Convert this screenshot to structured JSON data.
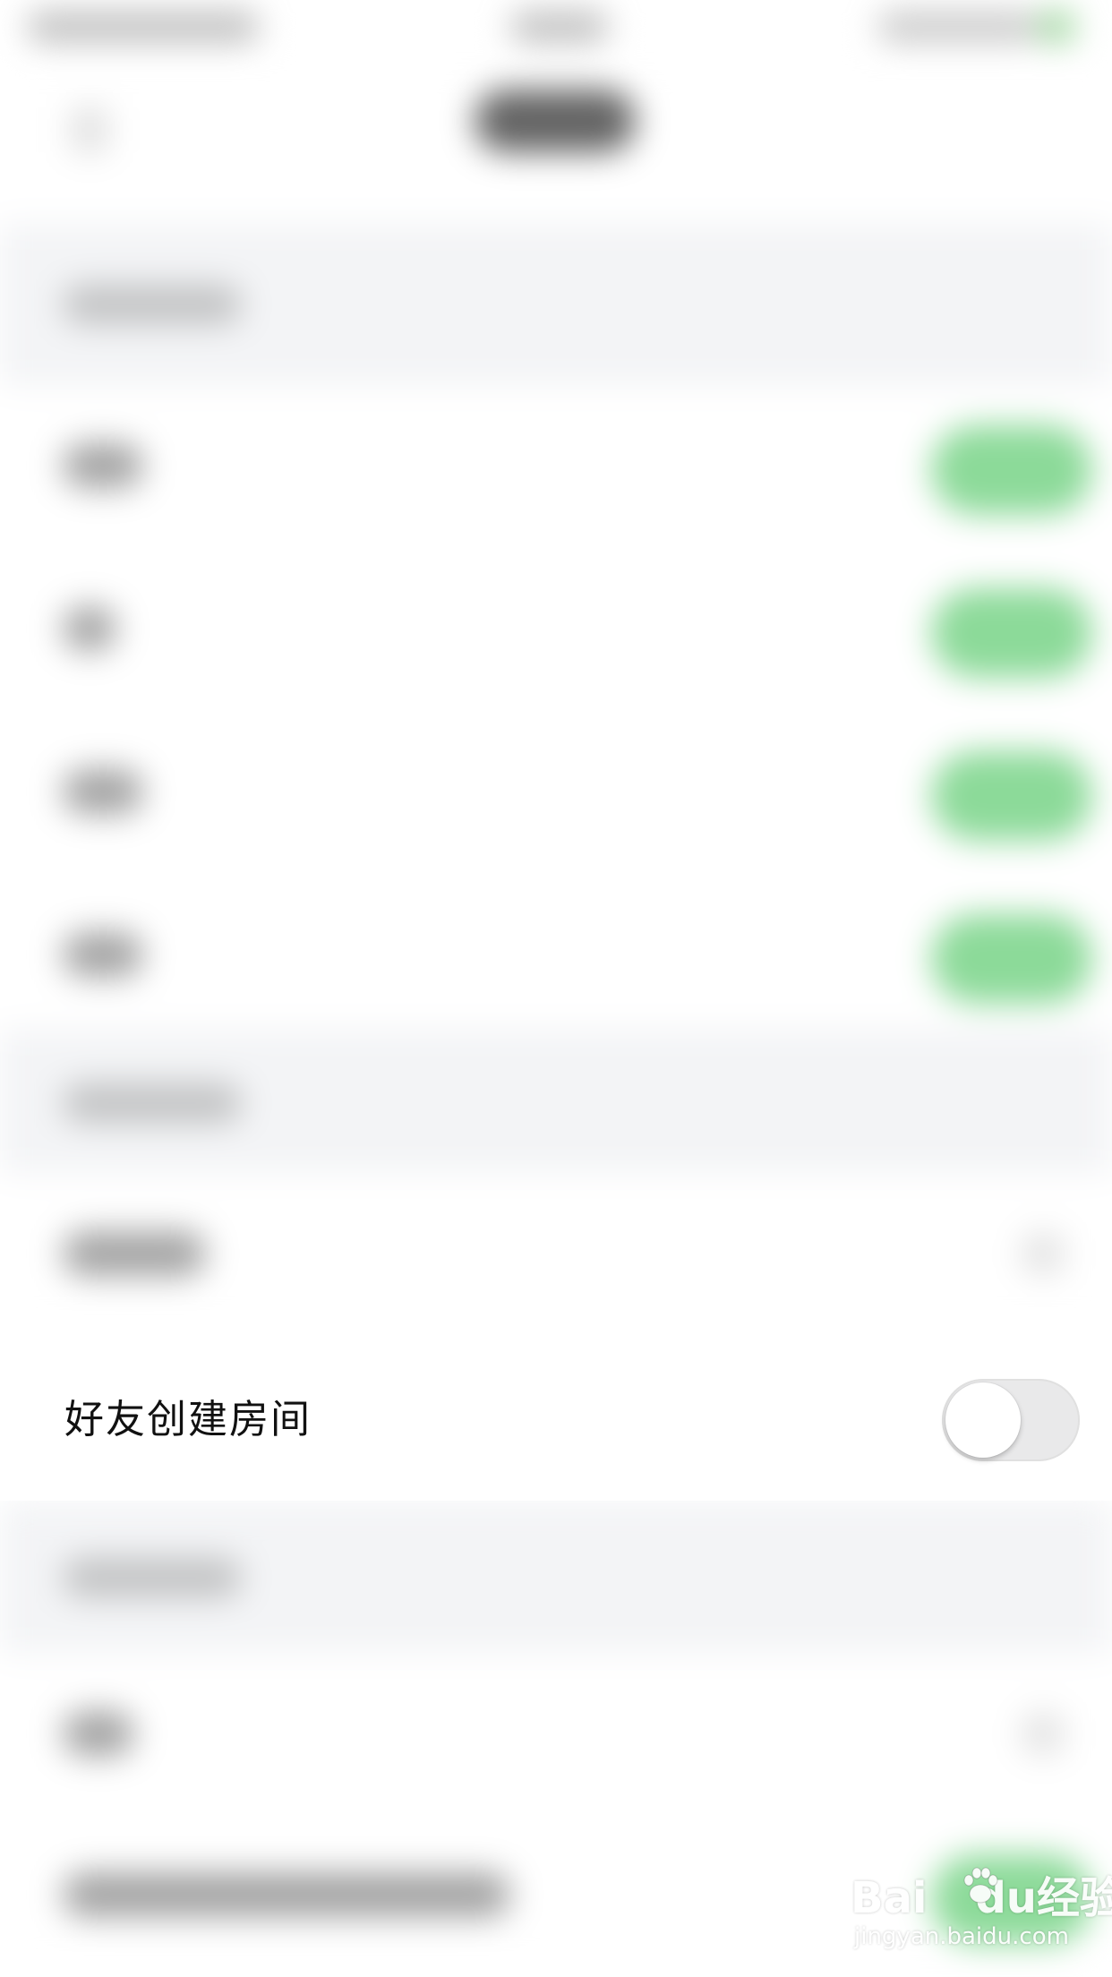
{
  "row": {
    "label": "好友创建房间",
    "toggle_on": false
  },
  "colors": {
    "switch_on": "#6fd17f",
    "switch_off": "#e9e9ea",
    "section_bg": "#f3f4f6"
  },
  "watermark": {
    "brand_latin_1": "Bai",
    "brand_latin_2": "du",
    "brand_cn": "经验",
    "url": "jingyan.baidu.com",
    "paw_icon": "paw-icon"
  }
}
